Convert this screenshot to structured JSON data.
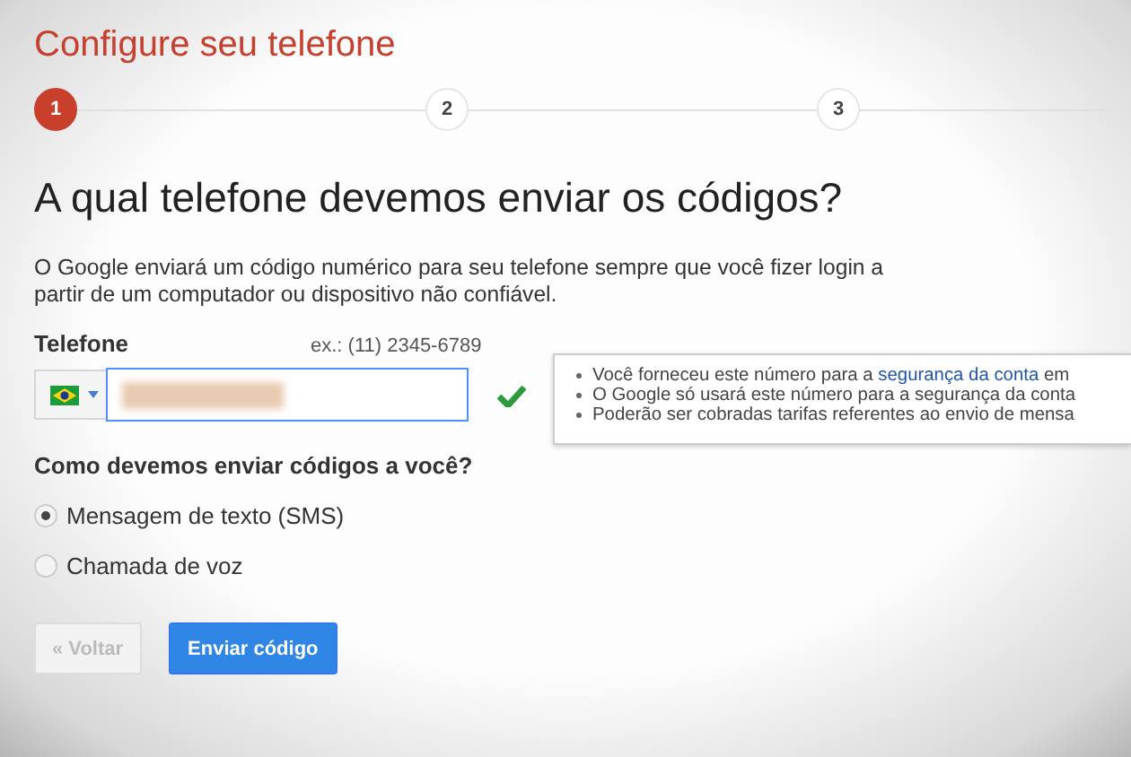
{
  "page_title": "Configure seu telefone",
  "steps": [
    {
      "label": "1",
      "selected": true
    },
    {
      "label": "2",
      "selected": false
    },
    {
      "label": "3",
      "selected": false
    }
  ],
  "heading": "A qual telefone devemos enviar os códigos?",
  "description": "O Google enviará um código numérico para seu telefone sempre que você fizer login a partir de um computador ou dispositivo não confiável.",
  "phone": {
    "label": "Telefone",
    "example": "ex.: (11) 2345-6789",
    "valid": true
  },
  "tooltip": [
    {
      "text": "Você forneceu este número para a ",
      "link": "segurança da conta",
      "after": " em"
    },
    {
      "text": "O Google só usará este número para a segurança da conta"
    },
    {
      "text": "Poderão ser cobradas tarifas referentes ao envio de mensa"
    }
  ],
  "method_question": "Como devemos enviar códigos a você?",
  "methods": [
    {
      "label": "Mensagem de texto (SMS)",
      "selected": true
    },
    {
      "label": "Chamada de voz",
      "selected": false
    }
  ],
  "buttons": [
    {
      "label": "« Voltar",
      "kind": "secondary",
      "disabled": true
    },
    {
      "label": "Enviar código",
      "kind": "primary",
      "disabled": false
    }
  ]
}
